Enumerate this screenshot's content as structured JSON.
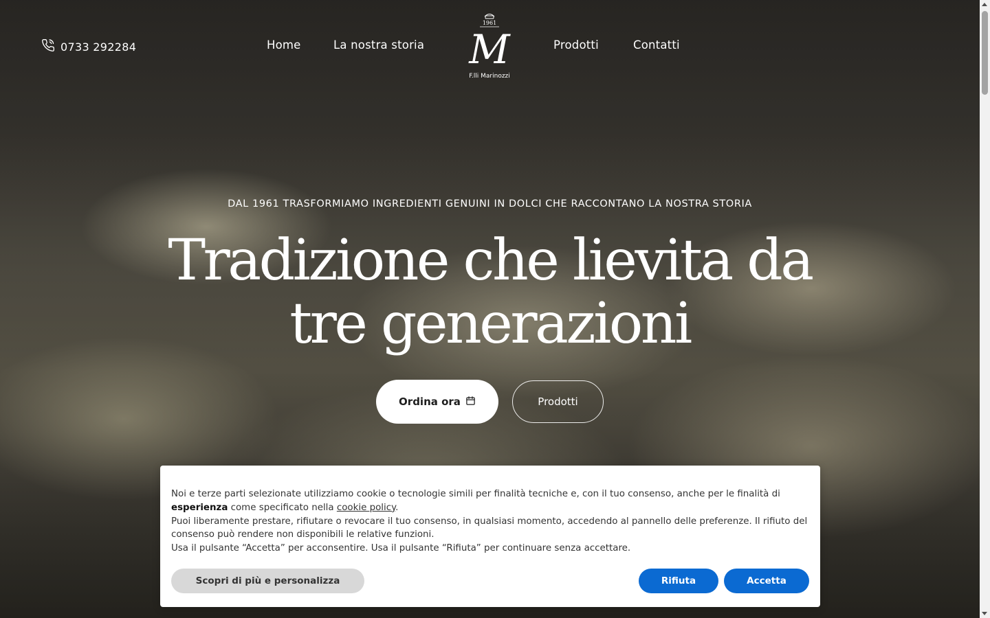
{
  "header": {
    "phone": "0733 292284",
    "nav": [
      "Home",
      "La nostra storia",
      "Prodotti",
      "Contatti"
    ],
    "logo": {
      "year": "1961",
      "monogram": "M",
      "name": "F.lli Marinozzi"
    }
  },
  "hero": {
    "eyebrow": "DAL 1961 TRASFORMIAMO INGREDIENTI GENUINI IN DOLCI CHE RACCONTANO LA NOSTRA STORIA",
    "headline_line1": "Tradizione che lievita da",
    "headline_line2": "tre generazioni",
    "order_label": "Ordina ora",
    "products_label": "Prodotti"
  },
  "cookie_banner": {
    "line1_pre": "Noi e terze parti selezionate utilizziamo cookie o tecnologie simili per finalità tecniche e, con il tuo consenso, anche per le finalità di",
    "line1_bold": "esperienza",
    "line1_mid": "come specificato nella",
    "policy_link": "cookie policy",
    "line2": "Puoi liberamente prestare, rifiutare o revocare il tuo consenso, in qualsiasi momento, accedendo al pannello delle preferenze. Il rifiuto del consenso può rendere non disponibili le relative funzioni.",
    "line3": "Usa il pulsante “Accetta” per acconsentire. Usa il pulsante “Rifiuta” per continuare senza accettare.",
    "more_label": "Scopri di più e personalizza",
    "reject_label": "Rifiuta",
    "accept_label": "Accetta"
  },
  "colors": {
    "accent_blue": "#0b6ad2",
    "secondary_button": "#d8d8d8"
  },
  "icons": [
    "phone-icon",
    "calendar-icon"
  ]
}
